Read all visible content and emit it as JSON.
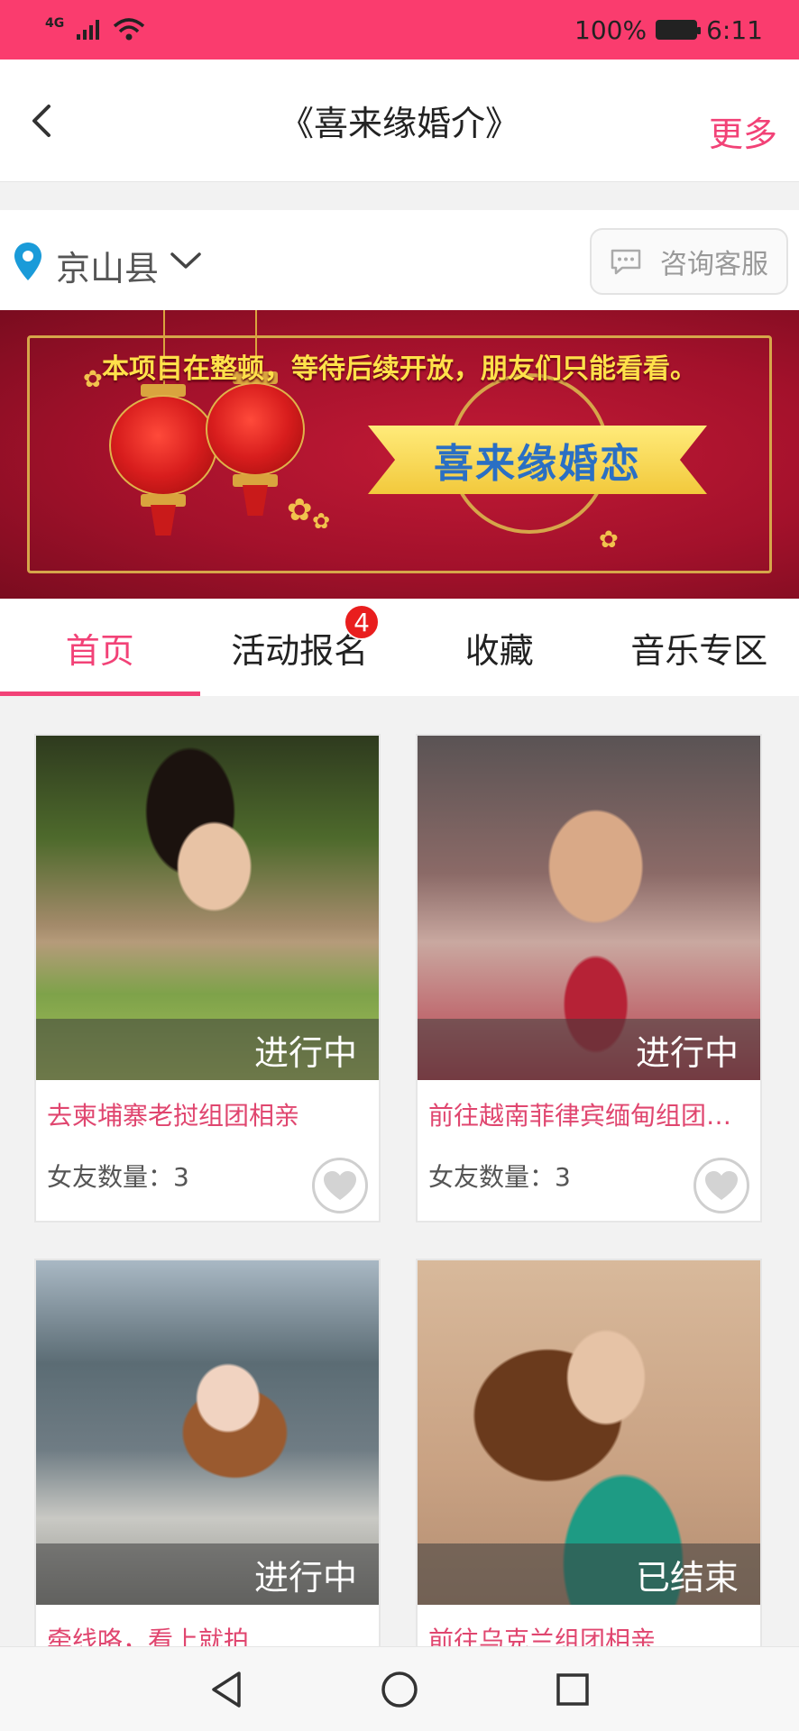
{
  "status_bar": {
    "network": "4G",
    "battery": "100%",
    "time": "6:11"
  },
  "titlebar": {
    "title": "《喜来缘婚介》",
    "more": "更多"
  },
  "location": {
    "city": "京山县",
    "consult": "咨询客服"
  },
  "banner": {
    "notice": "本项目在整顿，等待后续开放，朋友们只能看看。",
    "ribbon_text": "喜来缘婚恋"
  },
  "tabs": [
    {
      "label": "首页",
      "active": true
    },
    {
      "label": "活动报名",
      "badge": "4"
    },
    {
      "label": "收藏"
    },
    {
      "label": "音乐专区"
    }
  ],
  "cards": [
    {
      "status": "进行中",
      "title": "去柬埔寨老挝组团相亲",
      "meta": "女友数量：3"
    },
    {
      "status": "进行中",
      "title": "前往越南菲律宾缅甸组团…",
      "meta": "女友数量：3"
    },
    {
      "status": "进行中",
      "title": "牵线咯，看上就拍"
    },
    {
      "status": "已结束",
      "title": "前往乌克兰组团相亲"
    }
  ],
  "colors": {
    "accent": "#f24277",
    "status_bar": "#fa3c6e"
  }
}
